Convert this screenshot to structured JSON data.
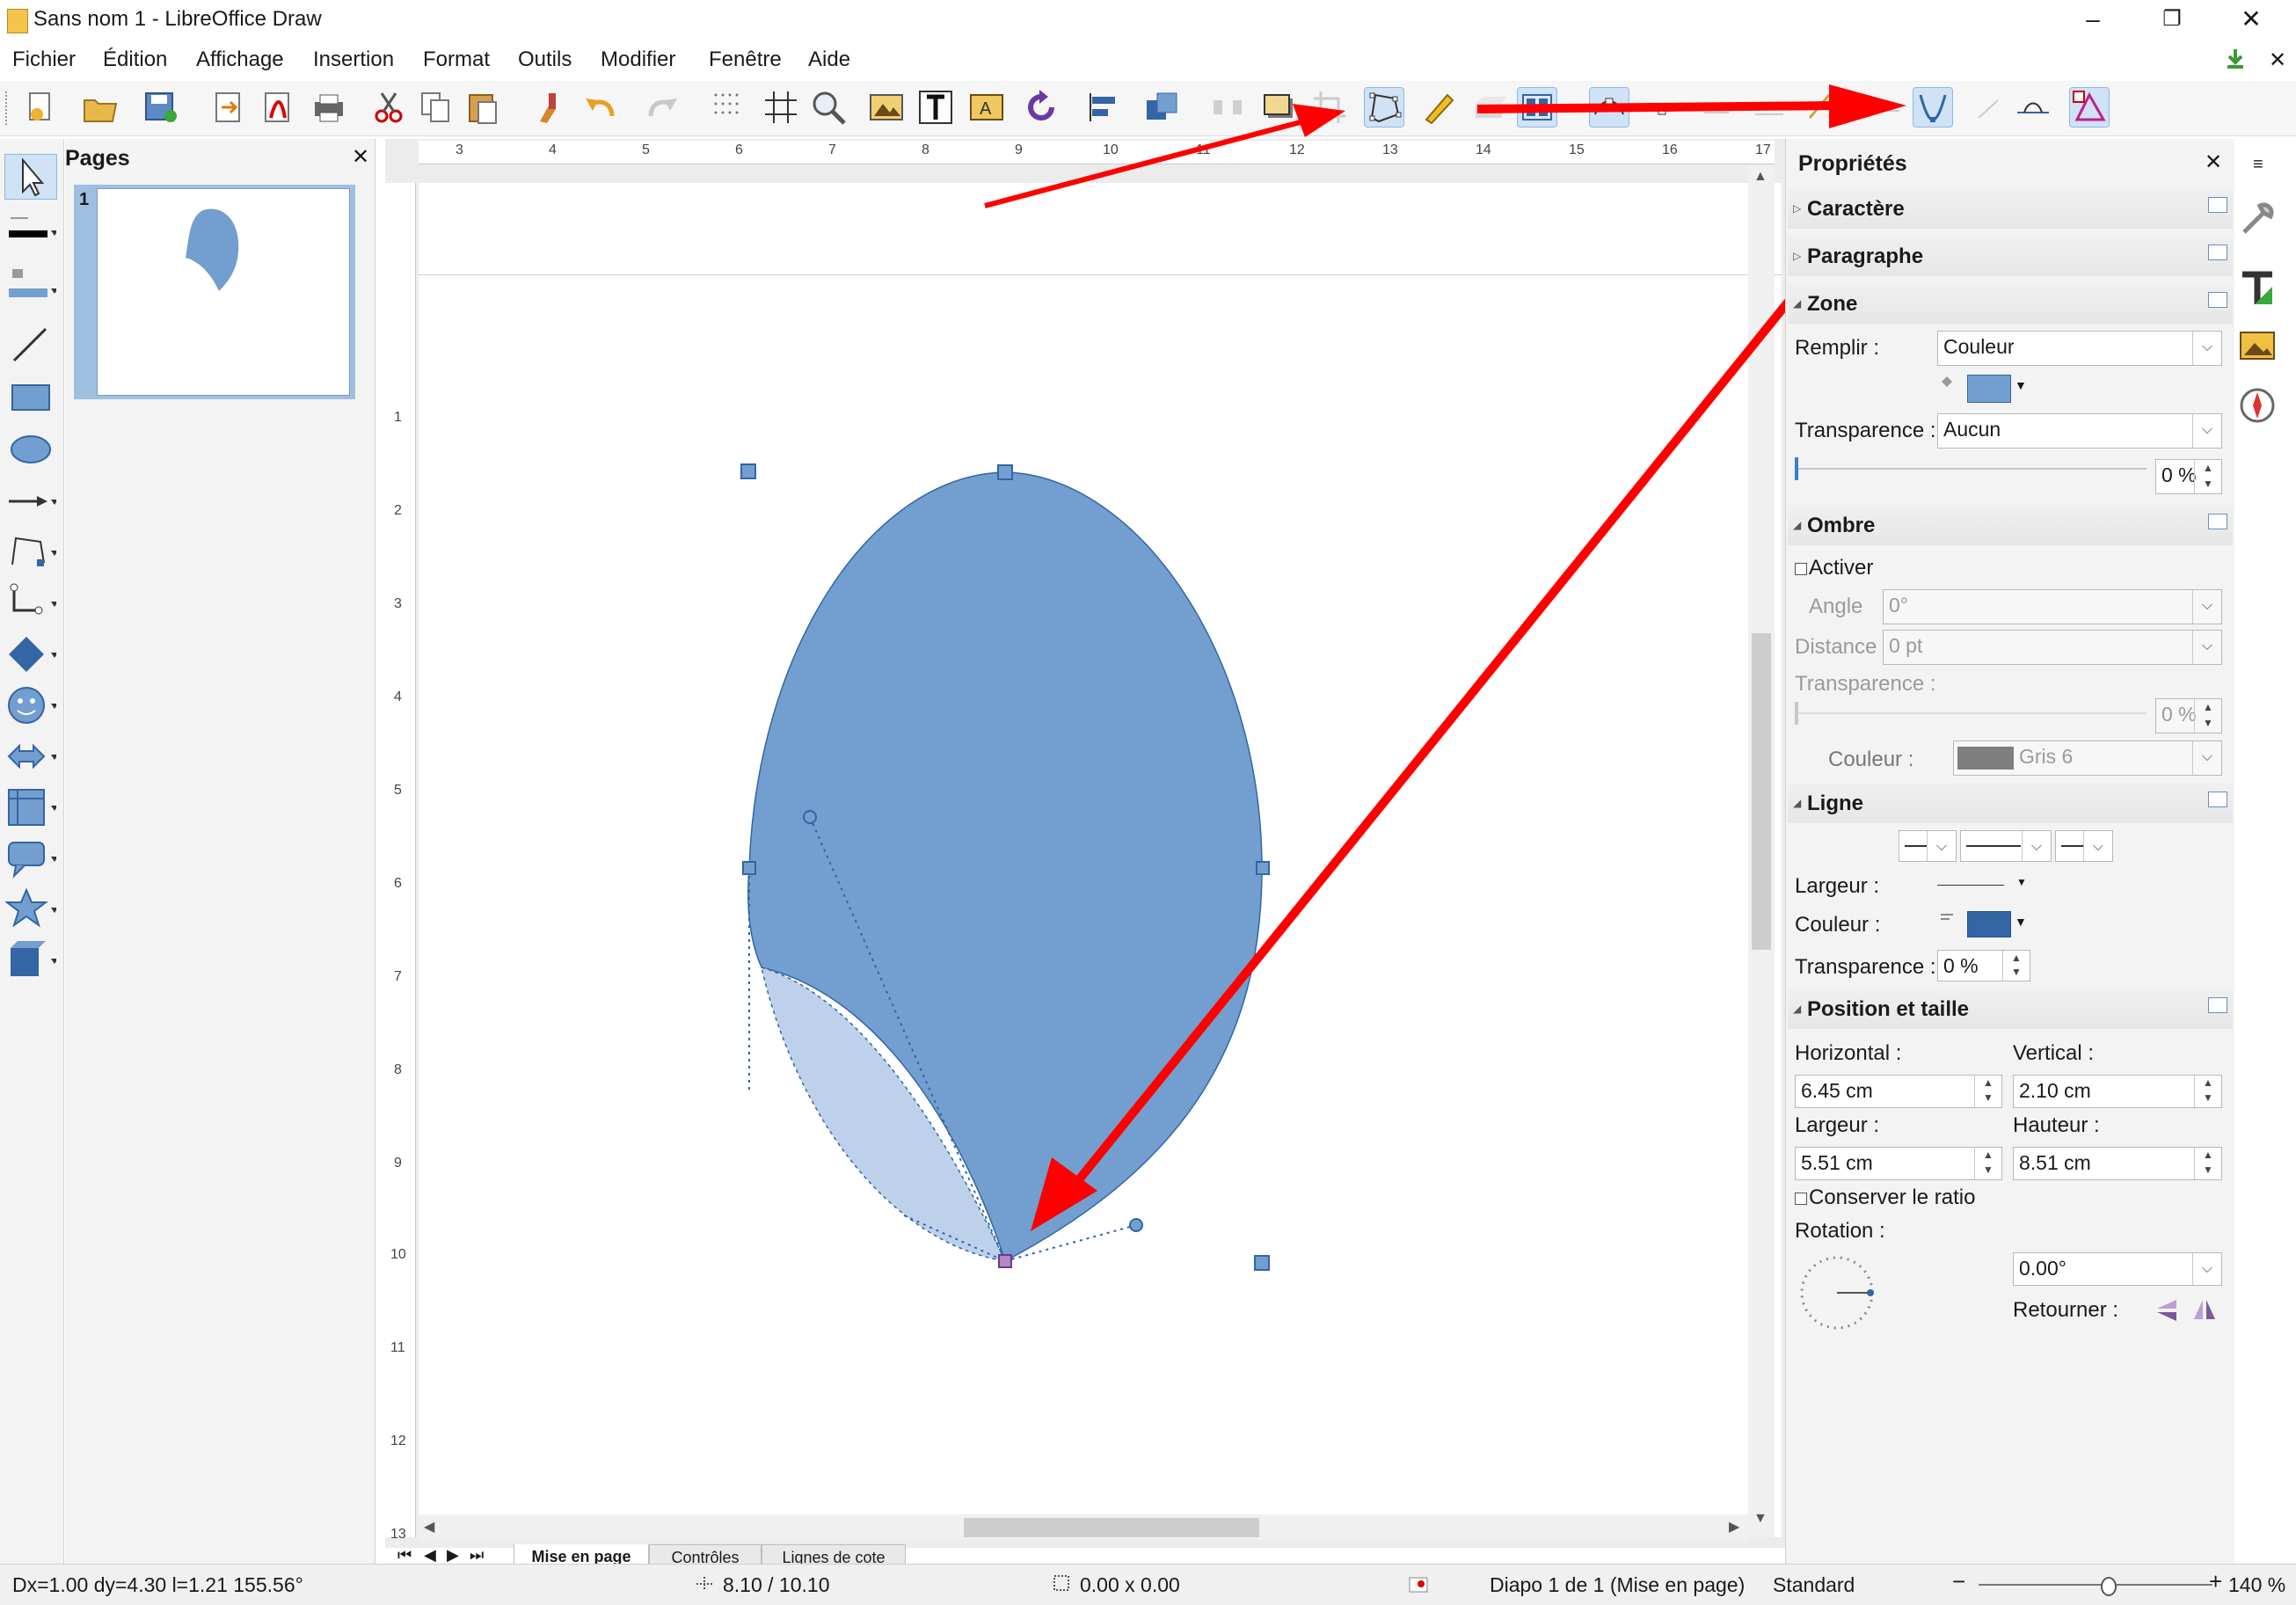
{
  "window": {
    "title": "Sans nom 1 - LibreOffice Draw",
    "controls": {
      "minimize": "–",
      "maximize": "❐",
      "close": "✕"
    }
  },
  "menu": {
    "items": [
      "Fichier",
      "Édition",
      "Affichage",
      "Insertion",
      "Format",
      "Outils",
      "Modifier",
      "Fenêtre",
      "Aide"
    ],
    "close_doc": "✕"
  },
  "toolbar": {
    "icons": [
      "new-icon",
      "open-icon",
      "save-icon",
      "export-icon",
      "export-pdf-icon",
      "print-icon",
      "cut-icon",
      "copy-icon",
      "paste-icon",
      "clone-formatting-icon",
      "undo-icon",
      "redo-icon",
      "grid-icon",
      "helplines-icon",
      "zoom-icon",
      "image-icon",
      "text-icon",
      "fontwork-icon",
      "rotate-icon",
      "align-icon",
      "arrange-icon",
      "distribute-icon",
      "shadow-icon",
      "crop-icon",
      "points-icon",
      "glue-points-icon",
      "toggle-extrusion-icon",
      "select-at-exit-icon",
      "transformation-icon",
      "move-points-icon",
      "insert-points-icon",
      "delete-points-icon",
      "split-curve-icon",
      "convert-to-curve-icon",
      "corner-point-icon",
      "smooth-transition-icon",
      "symmetric-transition-icon",
      "close-bezier-icon",
      "eliminate-points-icon"
    ]
  },
  "pages_pane": {
    "title": "Pages",
    "close": "✕",
    "page_number": "1"
  },
  "ruler": {
    "h_ticks": [
      "3",
      "4",
      "5",
      "6",
      "7",
      "8",
      "9",
      "10",
      "11",
      "12",
      "13",
      "14",
      "15",
      "16",
      "17"
    ],
    "v_ticks": [
      "1",
      "2",
      "3",
      "4",
      "5",
      "6",
      "7",
      "8",
      "9",
      "10",
      "11",
      "12",
      "13"
    ]
  },
  "sheet_tabs": [
    "Mise en page",
    "Contrôles",
    "Lignes de cote"
  ],
  "sidebar": {
    "title": "Propriétés",
    "close": "✕",
    "sections": {
      "caractere": "Caractère",
      "paragraphe": "Paragraphe",
      "zone": "Zone",
      "ombre": "Ombre",
      "ligne": "Ligne",
      "position": "Position et taille"
    },
    "zone": {
      "remplir_label": "Remplir :",
      "remplir_value": "Couleur",
      "fill_color": "#729fcf",
      "transparence_label": "Transparence :",
      "transparence_value": "Aucun",
      "transparence_pct": "0 %",
      "transparence_level": 0
    },
    "ombre": {
      "activer": "Activer",
      "angle_label": "Angle",
      "angle_value": "0°",
      "distance_label": "Distance",
      "distance_value": "0 pt",
      "transparence_label": "Transparence :",
      "transparence_pct": "0 %",
      "couleur_label": "Couleur :",
      "couleur_value": "Gris 6",
      "couleur_swatch": "#7f7f7f"
    },
    "ligne": {
      "largeur_label": "Largeur :",
      "couleur_label": "Couleur :",
      "couleur_swatch": "#3465a4",
      "transparence_label": "Transparence :",
      "transparence_value": "0 %"
    },
    "position": {
      "horizontal_label": "Horizontal :",
      "horizontal_value": "6.45 cm",
      "vertical_label": "Vertical :",
      "vertical_value": "2.10 cm",
      "largeur_label": "Largeur :",
      "largeur_value": "5.51 cm",
      "hauteur_label": "Hauteur :",
      "hauteur_value": "8.51 cm",
      "ratio_label": "Conserver le ratio",
      "rotation_label": "Rotation :",
      "rotation_value": "0.00°",
      "retourner_label": "Retourner :"
    }
  },
  "statusbar": {
    "coords": "Dx=1.00 dy=4.30  l=1.21 155.56°",
    "position": "8.10 / 10.10",
    "size": "0.00 x 0.00",
    "slide": "Diapo 1 de 1 (Mise en page)",
    "layout": "Standard",
    "zoom": "140 %",
    "zoom_level": 0.55
  },
  "colors": {
    "shape_fill": "#729fcf",
    "shape_stroke": "#3465a4",
    "arrow": "#ff0000",
    "selection": "#cfe2f6"
  }
}
